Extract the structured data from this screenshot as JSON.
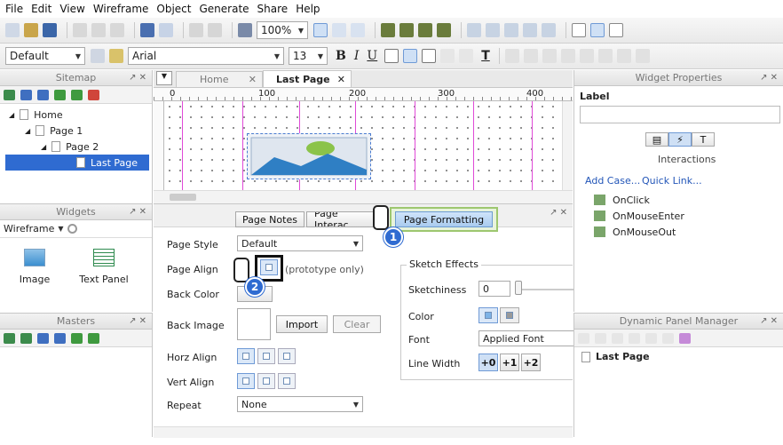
{
  "menu": [
    "File",
    "Edit",
    "View",
    "Wireframe",
    "Object",
    "Generate",
    "Share",
    "Help"
  ],
  "toolbar1": {
    "zoom": "100%"
  },
  "toolbar2": {
    "style": "Default",
    "font": "Arial",
    "size": "13",
    "bold": "B",
    "italic": "I",
    "underline": "U",
    "text_color": "T"
  },
  "sitemap": {
    "title": "Sitemap",
    "items": [
      "Home",
      "Page 1",
      "Page 2",
      "Last Page"
    ]
  },
  "widgets": {
    "title": "Widgets",
    "library": "Wireframe",
    "items": [
      "Image",
      "Text Panel"
    ]
  },
  "masters": {
    "title": "Masters"
  },
  "tabs": {
    "home": "Home",
    "last": "Last Page"
  },
  "ruler": [
    "0",
    "100",
    "200",
    "300",
    "400"
  ],
  "page_tabs": [
    "Page Notes",
    "Page Interac",
    "Page Formatting"
  ],
  "formatting": {
    "style_label": "Page Style",
    "style_value": "Default",
    "align_label": "Page Align",
    "align_note": "(prototype only)",
    "backcolor_label": "Back Color",
    "backimage_label": "Back Image",
    "import": "Import",
    "clear": "Clear",
    "horz_label": "Horz Align",
    "vert_label": "Vert Align",
    "repeat_label": "Repeat",
    "repeat_value": "None"
  },
  "sketch": {
    "title": "Sketch Effects",
    "sketchiness_label": "Sketchiness",
    "sketchiness_value": "0",
    "color_label": "Color",
    "font_label": "Font",
    "font_value": "Applied Font",
    "linewidth_label": "Line Width",
    "lw": [
      "+0",
      "+1",
      "+2"
    ]
  },
  "props": {
    "title": "Widget Properties",
    "label": "Label",
    "interactions": "Interactions",
    "add_case": "Add Case...",
    "quick_link": "Quick Link...",
    "events": [
      "OnClick",
      "OnMouseEnter",
      "OnMouseOut"
    ]
  },
  "dpm": {
    "title": "Dynamic Panel Manager",
    "item": "Last Page"
  },
  "callouts": [
    "1",
    "2"
  ],
  "panel_ctl": "↗ ✕"
}
